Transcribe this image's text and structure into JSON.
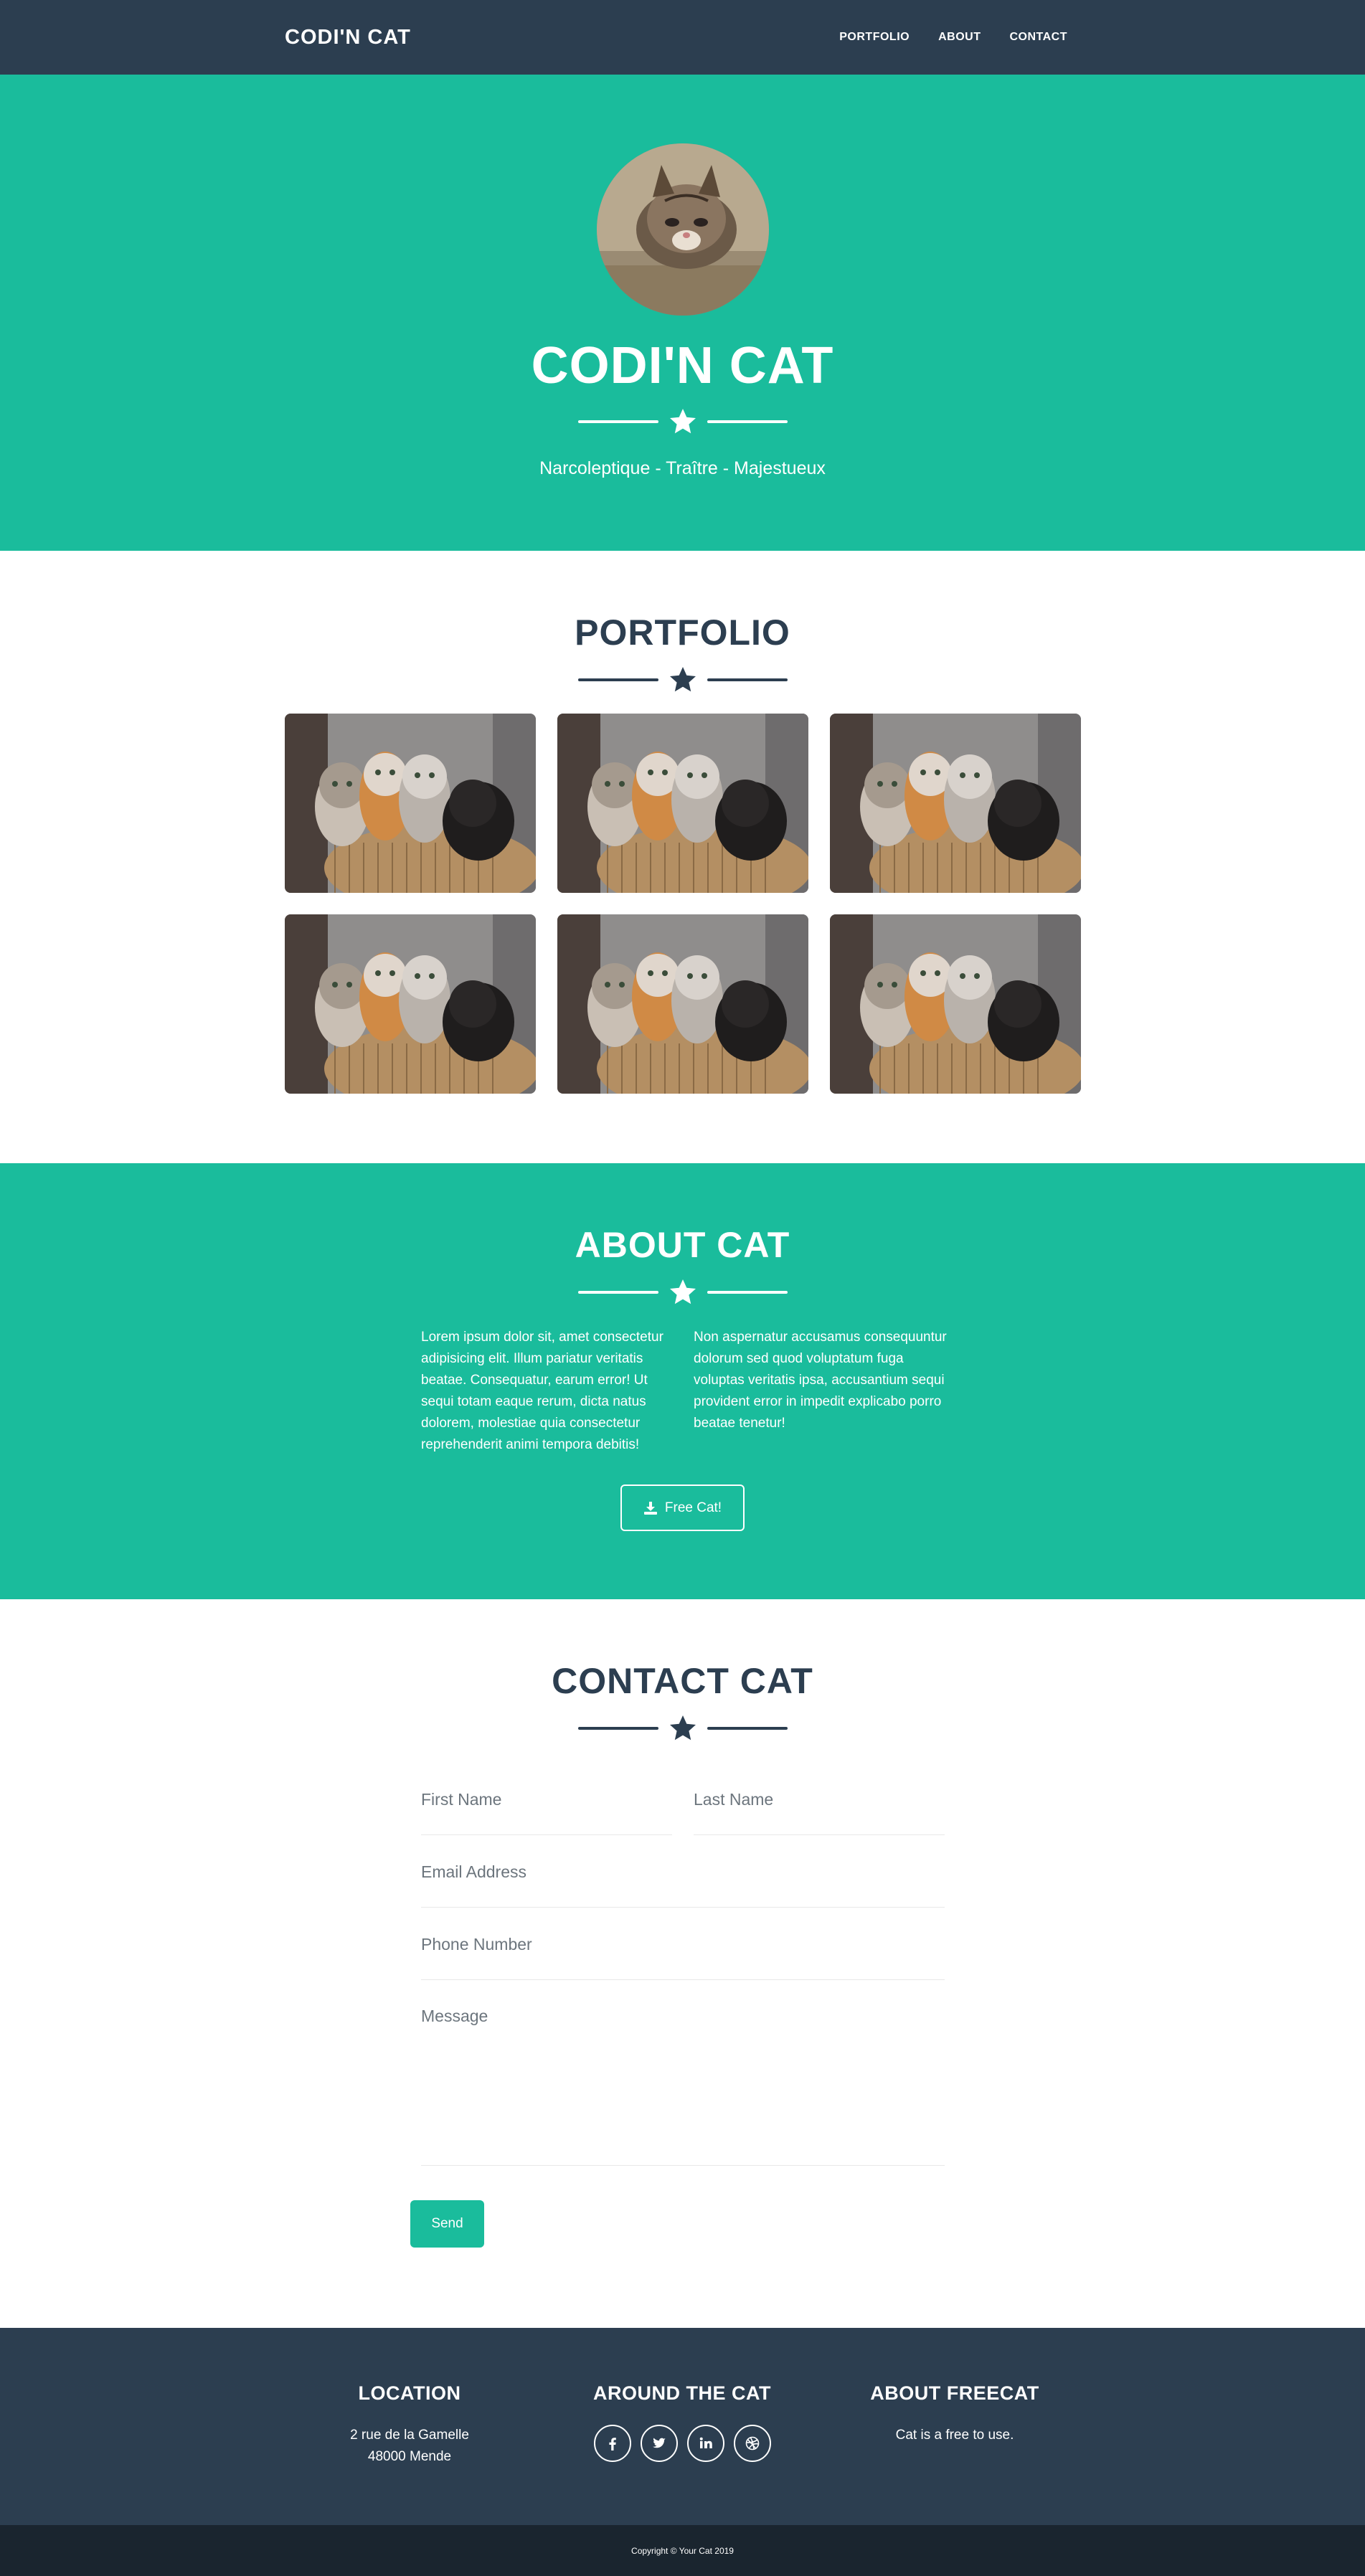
{
  "nav": {
    "brand": "CODI'N CAT",
    "links": [
      "PORTFOLIO",
      "ABOUT",
      "CONTACT"
    ]
  },
  "masthead": {
    "title": "CODI'N CAT",
    "subtitle": "Narcoleptique - Traître - Majestueux"
  },
  "portfolio": {
    "title": "PORTFOLIO",
    "items": [
      "kittens-photo",
      "kittens-photo",
      "kittens-photo",
      "kittens-photo",
      "kittens-photo",
      "kittens-photo"
    ]
  },
  "about": {
    "title": "ABOUT CAT",
    "col_left": "Lorem ipsum dolor sit, amet consectetur adipisicing elit. Illum pariatur veritatis beatae. Consequatur, earum error! Ut sequi totam eaque rerum, dicta natus dolorem, molestiae quia consectetur reprehenderit animi tempora debitis!",
    "col_right": "Non aspernatur accusamus consequuntur dolorum sed quod voluptatum fuga voluptas veritatis ipsa, accusantium sequi provident error in impedit explicabo porro beatae tenetur!",
    "button_label": "Free Cat!"
  },
  "contact": {
    "title": "CONTACT CAT",
    "first_name_placeholder": "First Name",
    "last_name_placeholder": "Last Name",
    "email_placeholder": "Email Address",
    "phone_placeholder": "Phone Number",
    "message_placeholder": "Message",
    "send_label": "Send"
  },
  "footer": {
    "location_title": "LOCATION",
    "address_line1": "2 rue de la Gamelle",
    "address_line2": "48000 Mende",
    "around_title": "AROUND THE CAT",
    "socials": [
      "facebook-icon",
      "twitter-icon",
      "linkedin-icon",
      "dribbble-icon"
    ],
    "about_title": "ABOUT FREECAT",
    "about_text": "Cat is a free to use.",
    "copyright": "Copyright © Your Cat 2019"
  },
  "colors": {
    "primary": "#1abc9c",
    "dark": "#2c3e50",
    "darker": "#1a252f"
  }
}
